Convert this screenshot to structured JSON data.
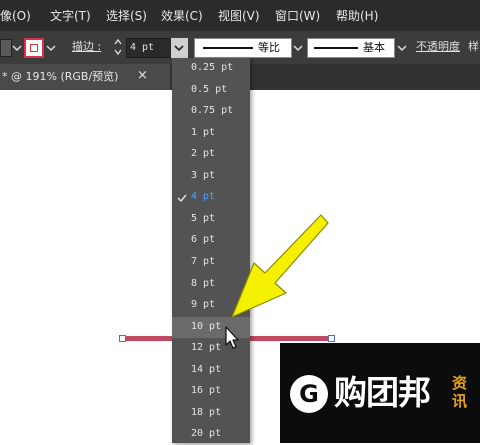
{
  "menubar": {
    "items": [
      "象(I)",
      "文字(T)",
      "选择(S)",
      "效果(C)",
      "视图(V)",
      "窗口(W)",
      "帮助(H)"
    ],
    "first_item": "像(O)"
  },
  "controlbar": {
    "stroke_label": "描边 :",
    "stroke_value": "4 pt",
    "profile_label": "等比",
    "brush_label": "基本",
    "opacity_label": "不透明度",
    "style_label": "样"
  },
  "tab": {
    "title": "* @ 191% (RGB/预览)",
    "close": "×"
  },
  "dropdown": {
    "selected": "4 pt",
    "hovered": "10 pt",
    "options": [
      "0.25 pt",
      "0.5 pt",
      "0.75 pt",
      "1 pt",
      "2 pt",
      "3 pt",
      "4 pt",
      "5 pt",
      "6 pt",
      "7 pt",
      "8 pt",
      "9 pt",
      "10 pt",
      "12 pt",
      "14 pt",
      "16 pt",
      "18 pt",
      "20 pt"
    ]
  },
  "watermark": {
    "brand": "购团邦",
    "tag_line1": "资",
    "tag_line2": "讯",
    "logo_letter": "G"
  },
  "colors": {
    "menubar_bg": "#2b2b2b",
    "controlbar_bg": "#3c3c3c",
    "dropdown_bg": "#535353",
    "selected_text": "#4aa3ff",
    "stroke_line": "#c24a63",
    "arrow_yellow": "#f5f000",
    "watermark_accent": "#e8a21a"
  }
}
